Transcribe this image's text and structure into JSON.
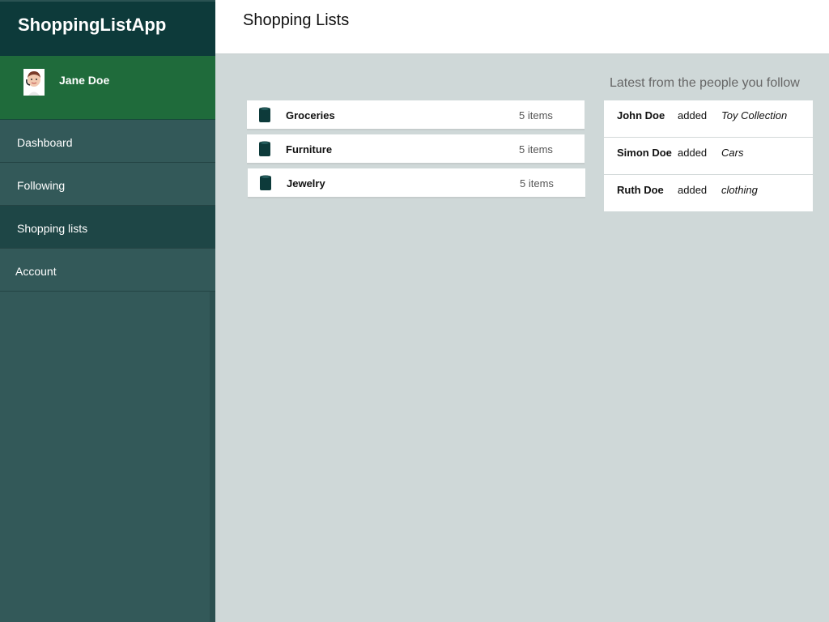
{
  "app": {
    "title": "ShoppingListApp"
  },
  "user": {
    "name": "Jane Doe",
    "avatar_icon": "user-avatar"
  },
  "nav": {
    "items": [
      {
        "label": "Dashboard",
        "active": false
      },
      {
        "label": "Following",
        "active": false
      },
      {
        "label": "Shopping lists",
        "active": true
      },
      {
        "label": "Account",
        "active": false
      }
    ]
  },
  "header": {
    "title": "Shopping Lists"
  },
  "lists": [
    {
      "name": "Groceries",
      "count": "5 items",
      "icon": "trash-can-icon"
    },
    {
      "name": "Furniture",
      "count": "5 items",
      "icon": "trash-can-icon"
    },
    {
      "name": "Jewelry",
      "count": "5 items",
      "icon": "trash-can-icon"
    }
  ],
  "feed": {
    "heading": "Latest from the people you follow",
    "items": [
      {
        "who": "John Doe",
        "verb": "added",
        "what": "Toy Collection"
      },
      {
        "who": "Simon Doe",
        "verb": "added",
        "what": "Cars"
      },
      {
        "who": "Ruth Doe",
        "verb": "added",
        "what": "clothing"
      }
    ]
  },
  "colors": {
    "sidebar": "#335959",
    "brand": "#0d3a3a",
    "user_panel": "#1f6b3b",
    "active_nav": "#1e4646",
    "content_bg": "#cfd8d8"
  }
}
